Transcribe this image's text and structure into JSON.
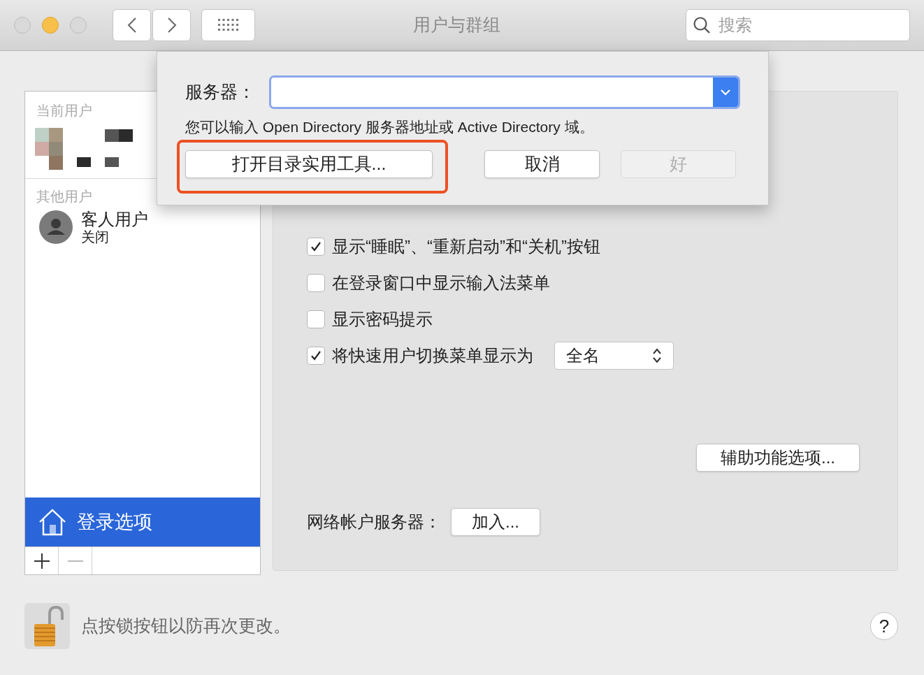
{
  "window": {
    "title": "用户与群组"
  },
  "toolbar": {
    "search_placeholder": "搜索"
  },
  "sidebar": {
    "current_header": "当前用户",
    "other_header": "其他用户",
    "others": [
      {
        "name": "客人用户",
        "status": "关闭"
      }
    ],
    "login_options": {
      "label": "登录选项",
      "selected": true
    }
  },
  "options": {
    "checkboxes": [
      {
        "label": "显示“睡眠”、“重新启动”和“关机”按钮",
        "checked": true,
        "kind": "plain"
      },
      {
        "label": "在登录窗口中显示输入法菜单",
        "checked": false,
        "kind": "plain"
      },
      {
        "label": "显示密码提示",
        "checked": false,
        "kind": "plain"
      },
      {
        "label": "将快速用户切换菜单显示为",
        "checked": true,
        "kind": "popup",
        "value": "全名"
      }
    ],
    "accessibility_button": "辅助功能选项...",
    "network_label": "网络帐户服务器：",
    "join_button": "加入..."
  },
  "sheet": {
    "server_label": "服务器：",
    "hint": "您可以输入 Open Directory 服务器地址或 Active Directory 域。",
    "buttons": [
      {
        "label": "打开目录实用工具...",
        "disabled": false,
        "highlighted": true
      },
      {
        "label": "取消",
        "disabled": false,
        "highlighted": false
      },
      {
        "label": "好",
        "disabled": true,
        "highlighted": false
      }
    ]
  },
  "lock": {
    "text": "点按锁按钮以防再次更改。"
  },
  "help": "?"
}
